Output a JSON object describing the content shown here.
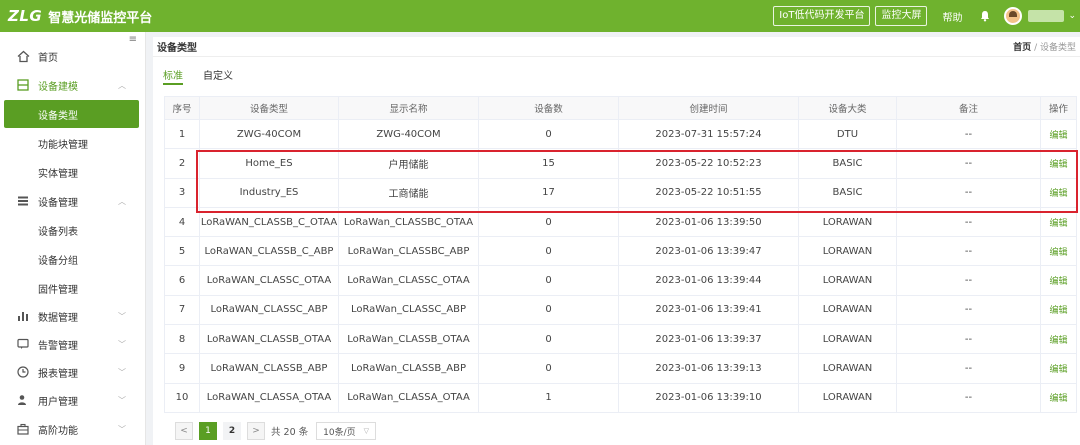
{
  "header": {
    "logo_mark": "ZLG",
    "title": "智慧光储监控平台",
    "btn_iot": "IoT低代码开发平台",
    "btn_screen": "监控大屏",
    "help": "帮助"
  },
  "sidebar": {
    "collapse_icon": "≡",
    "home": "首页",
    "device_modeling": "设备建模",
    "device_type": "设备类型",
    "function_block": "功能块管理",
    "entity": "实体管理",
    "device_mgmt": "设备管理",
    "device_list": "设备列表",
    "device_group": "设备分组",
    "firmware": "固件管理",
    "data_mgmt": "数据管理",
    "alarm_mgmt": "告警管理",
    "report_mgmt": "报表管理",
    "user_mgmt": "用户管理",
    "advanced": "高阶功能"
  },
  "panel": {
    "title": "设备类型",
    "breadcrumb_home": "首页",
    "breadcrumb_sep": "/",
    "breadcrumb_current": "设备类型"
  },
  "tabs": {
    "standard": "标准",
    "custom": "自定义"
  },
  "table": {
    "headers": [
      "序号",
      "设备类型",
      "显示名称",
      "设备数",
      "创建时间",
      "设备大类",
      "备注",
      "操作"
    ],
    "rows": [
      [
        "1",
        "ZWG-40COM",
        "ZWG-40COM",
        "0",
        "2023-07-31 15:57:24",
        "DTU",
        "--",
        "编辑"
      ],
      [
        "2",
        "Home_ES",
        "户用储能",
        "15",
        "2023-05-22 10:52:23",
        "BASIC",
        "--",
        "编辑"
      ],
      [
        "3",
        "Industry_ES",
        "工商储能",
        "17",
        "2023-05-22 10:51:55",
        "BASIC",
        "--",
        "编辑"
      ],
      [
        "4",
        "LoRaWAN_CLASSB_C_OTAA",
        "LoRaWan_CLASSBC_OTAA",
        "0",
        "2023-01-06 13:39:50",
        "LORAWAN",
        "--",
        "编辑"
      ],
      [
        "5",
        "LoRaWAN_CLASSB_C_ABP",
        "LoRaWan_CLASSBC_ABP",
        "0",
        "2023-01-06 13:39:47",
        "LORAWAN",
        "--",
        "编辑"
      ],
      [
        "6",
        "LoRaWAN_CLASSC_OTAA",
        "LoRaWan_CLASSC_OTAA",
        "0",
        "2023-01-06 13:39:44",
        "LORAWAN",
        "--",
        "编辑"
      ],
      [
        "7",
        "LoRaWAN_CLASSC_ABP",
        "LoRaWan_CLASSC_ABP",
        "0",
        "2023-01-06 13:39:41",
        "LORAWAN",
        "--",
        "编辑"
      ],
      [
        "8",
        "LoRaWAN_CLASSB_OTAA",
        "LoRaWan_CLASSB_OTAA",
        "0",
        "2023-01-06 13:39:37",
        "LORAWAN",
        "--",
        "编辑"
      ],
      [
        "9",
        "LoRaWAN_CLASSB_ABP",
        "LoRaWan_CLASSB_ABP",
        "0",
        "2023-01-06 13:39:13",
        "LORAWAN",
        "--",
        "编辑"
      ],
      [
        "10",
        "LoRaWAN_CLASSA_OTAA",
        "LoRaWan_CLASSA_OTAA",
        "1",
        "2023-01-06 13:39:10",
        "LORAWAN",
        "--",
        "编辑"
      ]
    ]
  },
  "pagination": {
    "prev": "<",
    "page1": "1",
    "page2": "2",
    "next": ">",
    "total": "共 20 条",
    "page_size": "10条/页"
  },
  "colors": {
    "brand": "#6fb22e",
    "accent": "#5a9e23",
    "highlight": "#d9232e"
  }
}
